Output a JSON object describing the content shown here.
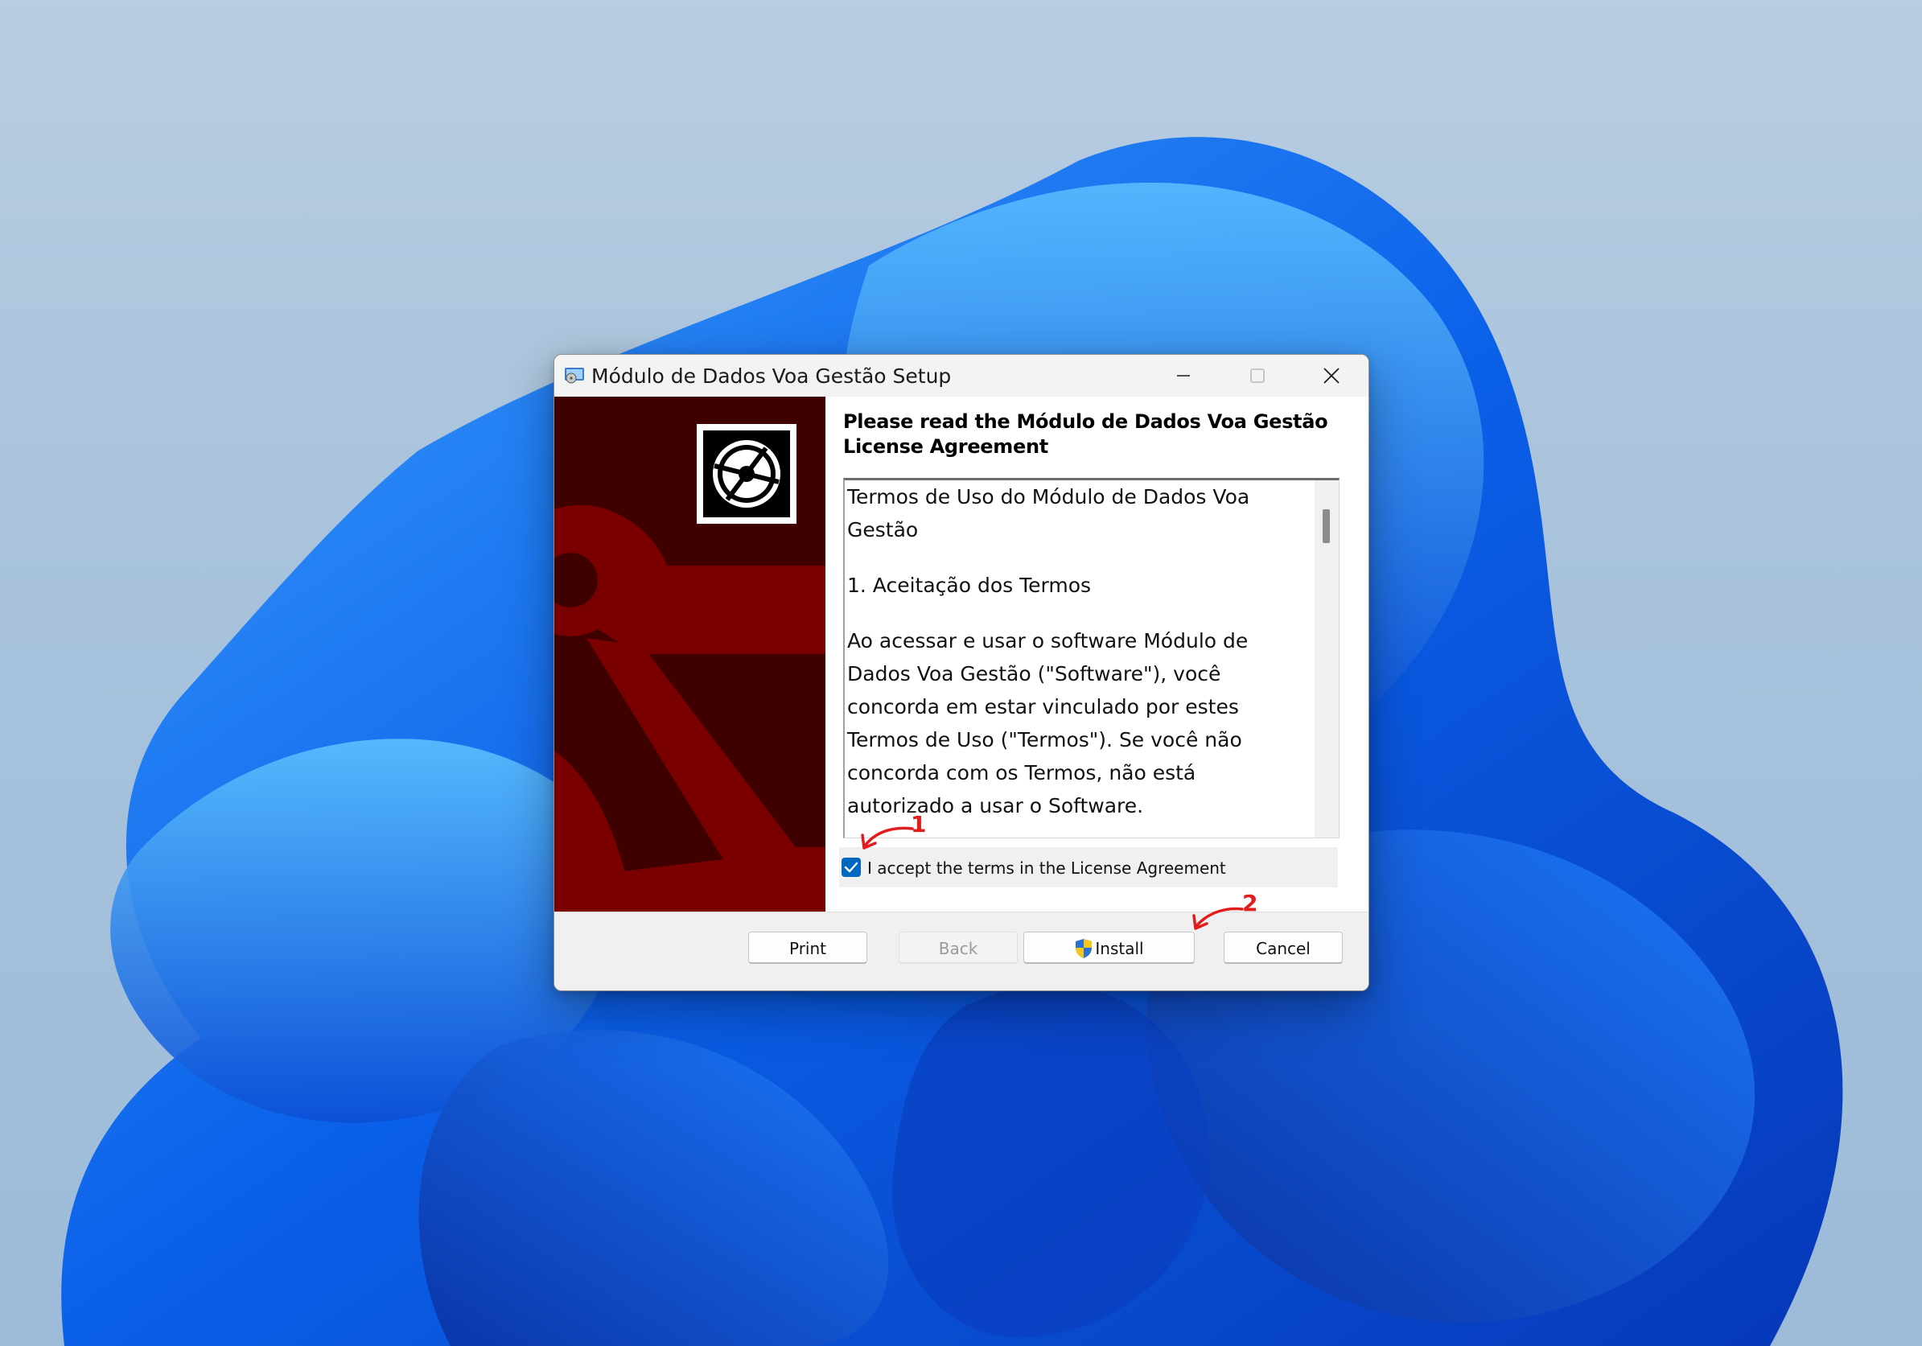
{
  "window": {
    "title": "Módulo de Dados Voa Gestão Setup",
    "controls": {
      "minimize": "minimize-icon",
      "maximize": "maximize-icon",
      "close": "close-icon"
    }
  },
  "banner": {
    "logo_icon": "installer-disc-icon",
    "background_color": "#3f0000",
    "accent_color": "#7a0000"
  },
  "content": {
    "heading": "Please read the Módulo de Dados Voa Gestão License Agreement",
    "license_paragraphs": [
      "Termos de Uso do Módulo de Dados Voa Gestão",
      "1. Aceitação dos Termos",
      "Ao acessar e usar o software Módulo de Dados Voa Gestão (\"Software\"), você concorda em estar vinculado por estes Termos de Uso (\"Termos\"). Se você não concorda com os Termos, não está autorizado a usar o Software."
    ],
    "accept_label": "I accept the terms in the License Agreement",
    "accept_checked": true
  },
  "footer": {
    "print_label": "Print",
    "back_label": "Back",
    "install_label": "Install",
    "cancel_label": "Cancel",
    "install_icon": "uac-shield-icon"
  },
  "annotations": [
    {
      "label": "1",
      "color": "#e11d1d"
    },
    {
      "label": "2",
      "color": "#e11d1d"
    }
  ]
}
